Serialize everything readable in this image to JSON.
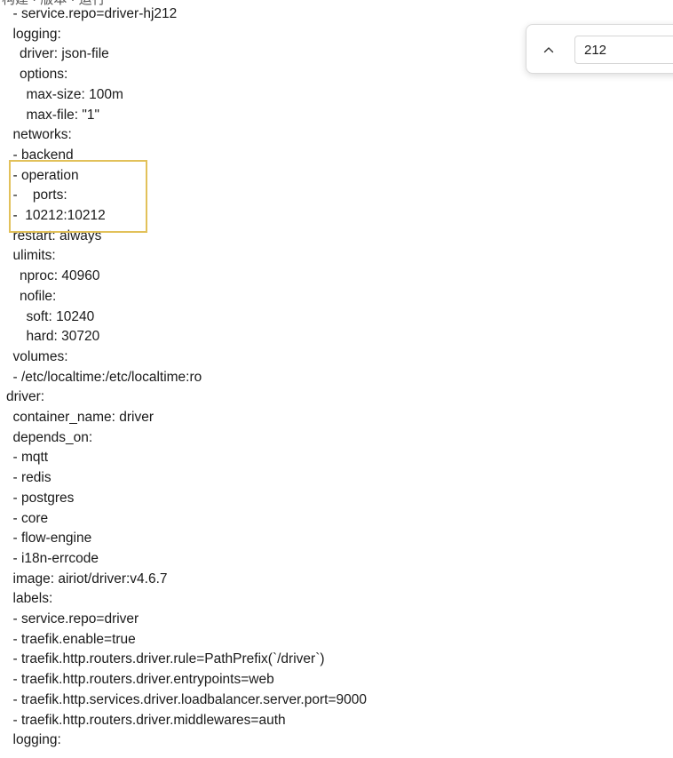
{
  "top_partial_text": "构建 · 版本 · 运行",
  "editor": {
    "lines": [
      {
        "indent": 2,
        "text": "- service.repo=driver-hj212"
      },
      {
        "indent": 2,
        "text": "logging:"
      },
      {
        "indent": 3,
        "text": "driver: json-file"
      },
      {
        "indent": 3,
        "text": "options:"
      },
      {
        "indent": 4,
        "text": "max-size: 100m"
      },
      {
        "indent": 4,
        "text": "max-file: \"1\""
      },
      {
        "indent": 2,
        "text": "networks:"
      },
      {
        "indent": 2,
        "text": "- backend"
      },
      {
        "indent": 2,
        "text": "- operation"
      },
      {
        "indent": 2,
        "text": "-    ports:"
      },
      {
        "indent": 2,
        "text": "-  10212:10212"
      },
      {
        "indent": 2,
        "text": "restart: always"
      },
      {
        "indent": 2,
        "text": "ulimits:"
      },
      {
        "indent": 3,
        "text": "nproc: 40960"
      },
      {
        "indent": 3,
        "text": "nofile:"
      },
      {
        "indent": 4,
        "text": "soft: 10240"
      },
      {
        "indent": 4,
        "text": "hard: 30720"
      },
      {
        "indent": 2,
        "text": "volumes:"
      },
      {
        "indent": 2,
        "text": "- /etc/localtime:/etc/localtime:ro"
      },
      {
        "indent": 1,
        "text": "driver:"
      },
      {
        "indent": 2,
        "text": "container_name: driver"
      },
      {
        "indent": 2,
        "text": "depends_on:"
      },
      {
        "indent": 2,
        "text": "- mqtt"
      },
      {
        "indent": 2,
        "text": "- redis"
      },
      {
        "indent": 2,
        "text": "- postgres"
      },
      {
        "indent": 2,
        "text": "- core"
      },
      {
        "indent": 2,
        "text": "- flow-engine"
      },
      {
        "indent": 2,
        "text": "- i18n-errcode"
      },
      {
        "indent": 2,
        "text": "image: airiot/driver:v4.6.7"
      },
      {
        "indent": 2,
        "text": "labels:"
      },
      {
        "indent": 2,
        "text": "- service.repo=driver"
      },
      {
        "indent": 2,
        "text": "- traefik.enable=true"
      },
      {
        "indent": 2,
        "text": "- traefik.http.routers.driver.rule=PathPrefix(`/driver`)"
      },
      {
        "indent": 2,
        "text": "- traefik.http.routers.driver.entrypoints=web"
      },
      {
        "indent": 2,
        "text": "- traefik.http.services.driver.loadbalancer.server.port=9000"
      },
      {
        "indent": 2,
        "text": "- traefik.http.routers.driver.middlewares=auth"
      },
      {
        "indent": 2,
        "text": "logging:"
      }
    ]
  },
  "find": {
    "query": "212",
    "prev_icon": "chevron-up-icon"
  }
}
